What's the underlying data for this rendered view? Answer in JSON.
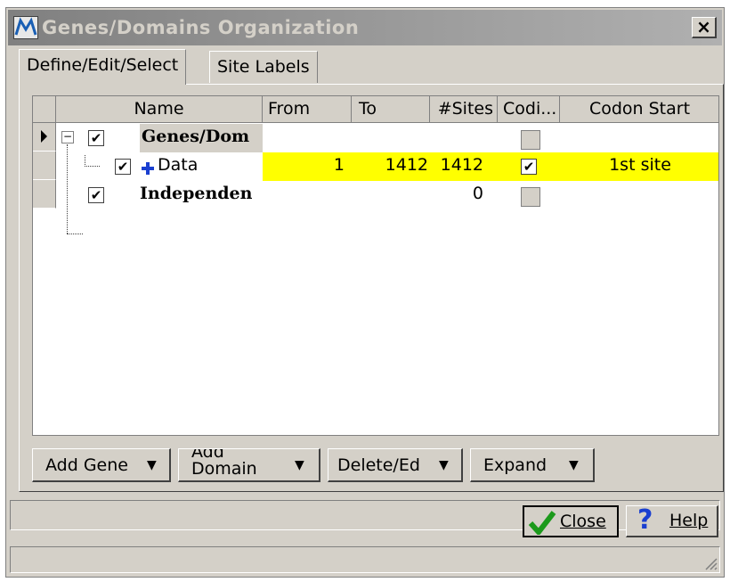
{
  "window": {
    "title": "Genes/Domains Organization",
    "close_glyph": "×"
  },
  "tabs": [
    {
      "label": "Define/Edit/Select",
      "active": true
    },
    {
      "label": "Site Labels",
      "active": false
    }
  ],
  "grid": {
    "columns": [
      "Name",
      "From",
      "To",
      "#Sites",
      "Codi...",
      "Codon Start"
    ],
    "rows": [
      {
        "name": "Genes/Dom",
        "from": "",
        "to": "",
        "sites": "",
        "coding": false,
        "codon_start": "",
        "checked": true,
        "selected": true
      },
      {
        "name": "Data",
        "from": "1",
        "to": "1412",
        "sites": "1412",
        "coding": true,
        "codon_start": "1st site",
        "checked": true,
        "highlight": "#ffff00"
      },
      {
        "name": "Independen",
        "from": "",
        "to": "",
        "sites": "0",
        "coding": false,
        "codon_start": "",
        "checked": true
      }
    ]
  },
  "toolbar": {
    "add_gene": "Add Gene",
    "add_domain": "Add\nDomain",
    "delete_edit": "Delete/Ed",
    "expand": "Expand"
  },
  "footer": {
    "close": "Close",
    "help": "Help"
  },
  "icons": [
    "row-pointer-icon",
    "tree-collapse-icon",
    "domain-plus-icon",
    "checkmark-icon",
    "help-question-icon",
    "resize-grip-icon"
  ]
}
